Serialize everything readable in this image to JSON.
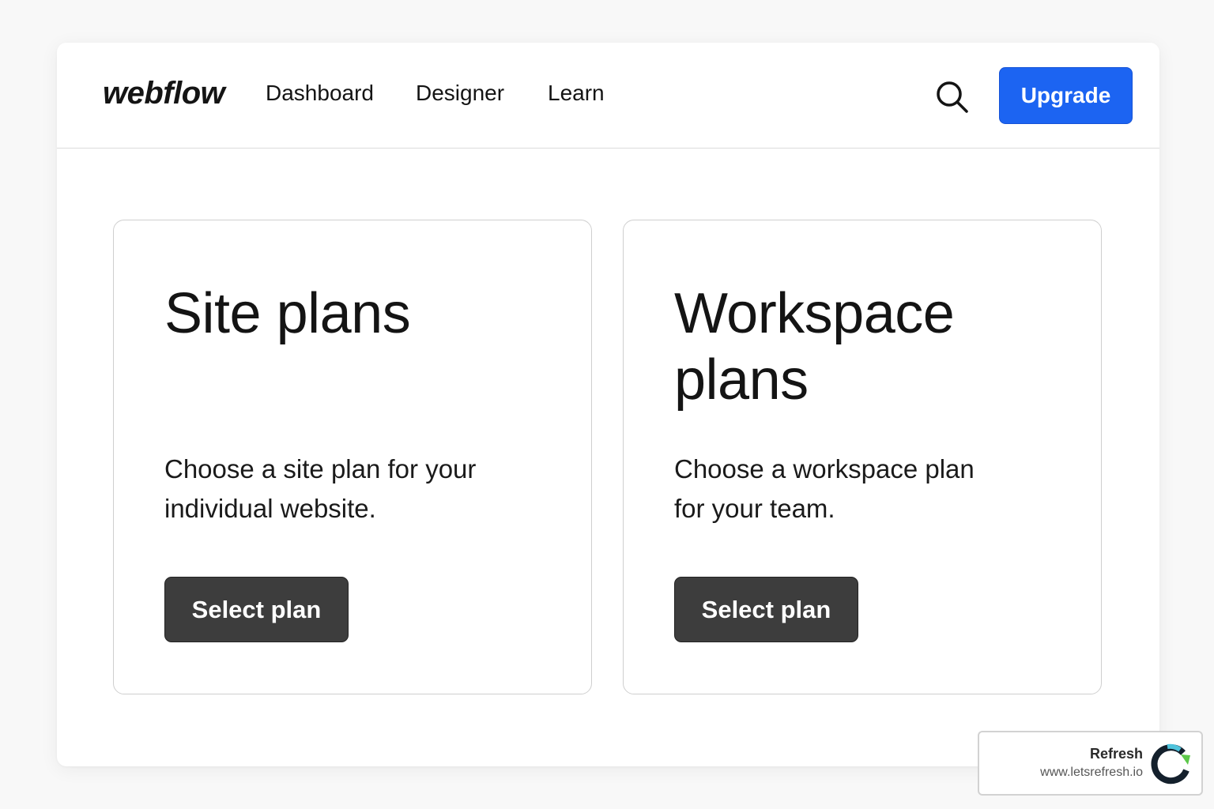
{
  "brand": {
    "logo": "webflow"
  },
  "nav": {
    "items": [
      {
        "label": "Dashboard"
      },
      {
        "label": "Designer"
      },
      {
        "label": "Learn"
      }
    ],
    "search_icon": "search-icon",
    "upgrade_label": "Upgrade"
  },
  "cards": [
    {
      "title": "Site plans",
      "description": "Choose a site plan for your individual website.",
      "button_label": "Select plan"
    },
    {
      "title": "Workspace plans",
      "description": "Choose a workspace plan for your team.",
      "button_label": "Select plan"
    }
  ],
  "badge": {
    "name": "Refresh",
    "url": "www.letsrefresh.io"
  },
  "colors": {
    "accent": "#1c64f2",
    "button_dark": "#3d3d3d"
  }
}
